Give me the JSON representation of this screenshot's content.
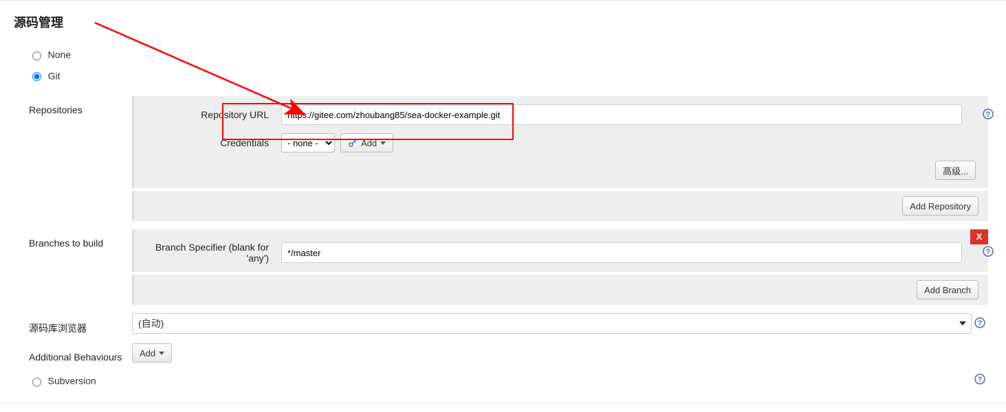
{
  "section_title": "源码管理",
  "scm": {
    "none_label": "None",
    "git_label": "Git",
    "subversion_label": "Subversion"
  },
  "repositories": {
    "heading": "Repositories",
    "repo_url_label": "Repository URL",
    "repo_url_value": "https://gitee.com/zhoubang85/sea-docker-example.git",
    "credentials_label": "Credentials",
    "credentials_selected": "- none -",
    "add_button": "Add",
    "advanced_button": "高级...",
    "add_repository_button": "Add Repository"
  },
  "branches": {
    "heading": "Branches to build",
    "branch_specifier_label": "Branch Specifier (blank for 'any')",
    "branch_specifier_value": "*/master",
    "close_label": "X",
    "add_branch_button": "Add Branch"
  },
  "browser": {
    "heading": "源码库浏览器",
    "selected": "(自动)"
  },
  "additional": {
    "heading": "Additional Behaviours",
    "add_button": "Add"
  }
}
